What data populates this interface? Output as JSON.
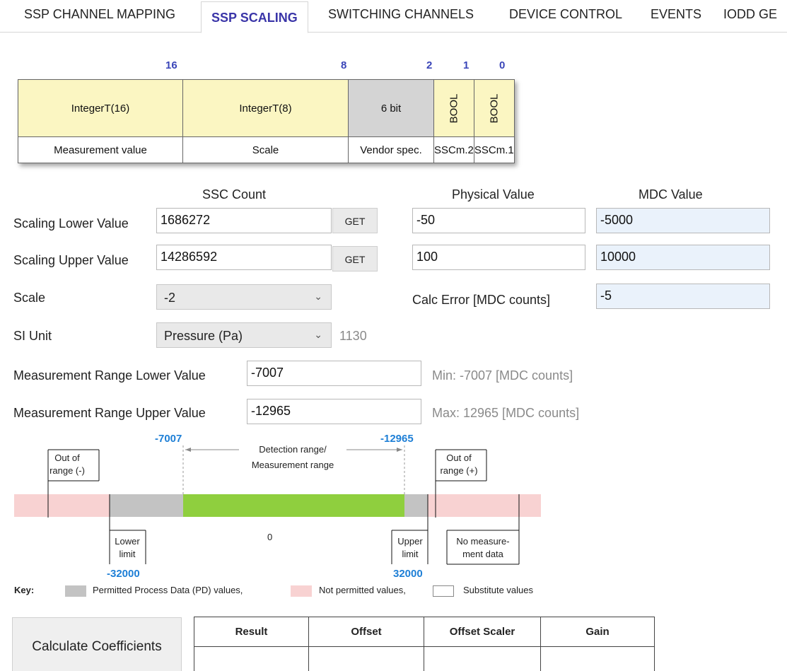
{
  "tabs": [
    {
      "label": "SSP CHANNEL MAPPING"
    },
    {
      "label": "SSP SCALING"
    },
    {
      "label": "SWITCHING CHANNELS"
    },
    {
      "label": "DEVICE CONTROL"
    },
    {
      "label": "EVENTS"
    },
    {
      "label": "IODD GE"
    }
  ],
  "bitlayout": {
    "bit_numbers": [
      "16",
      "8",
      "2",
      "1",
      "0"
    ],
    "types": [
      "IntegerT(16)",
      "IntegerT(8)",
      "6 bit",
      "BOOL",
      "BOOL"
    ],
    "names": [
      "Measurement value",
      "Scale",
      "Vendor spec.",
      "SSCm.2",
      "SSCm.1"
    ]
  },
  "form": {
    "headers": {
      "ssc_count": "SSC Count",
      "physical": "Physical Value",
      "mdc": "MDC Value"
    },
    "scaling_lower": {
      "label": "Scaling Lower Value",
      "ssc": "1686272",
      "get": "GET",
      "physical": "-50",
      "mdc": "-5000"
    },
    "scaling_upper": {
      "label": "Scaling Upper Value",
      "ssc": "14286592",
      "get": "GET",
      "physical": "100",
      "mdc": "10000"
    },
    "scale": {
      "label": "Scale",
      "value": "-2"
    },
    "calc_error": {
      "label": "Calc Error [MDC counts]",
      "value": "-5"
    },
    "si_unit": {
      "label": "SI Unit",
      "value": "Pressure (Pa)",
      "code": "1130"
    },
    "range_lower": {
      "label": "Measurement Range Lower Value",
      "value": "-7007",
      "hint": "Min: -7007 [MDC counts]"
    },
    "range_upper": {
      "label": "Measurement Range Upper Value",
      "value": "-12965",
      "hint": "Max: 12965 [MDC counts]"
    }
  },
  "diagram": {
    "top_left_value": "-7007",
    "top_right_value": "-12965",
    "detection_line1": "Detection range/",
    "detection_line2": "Measurement range",
    "out_minus_1": "Out of",
    "out_minus_2": "range (-)",
    "out_plus_1": "Out of",
    "out_plus_2": "range (+)",
    "zero": "0",
    "lower_limit_1": "Lower",
    "lower_limit_2": "limit",
    "upper_limit_1": "Upper",
    "upper_limit_2": "limit",
    "no_data_1": "No measure-",
    "no_data_2": "ment data",
    "bottom_left_value": "-32000",
    "bottom_right_value": "32000"
  },
  "key": {
    "title": "Key:",
    "permitted": "Permitted Process Data (PD) values,",
    "not_permitted": "Not permitted values,",
    "substitute": "Substitute values",
    "colors": {
      "permitted": "#c3c3c3",
      "not_permitted": "#f8d2d2",
      "substitute": "#ffffff",
      "range": "#8fcf3e"
    }
  },
  "results": {
    "calculate_label": "Calculate Coefficients",
    "columns": [
      "Result",
      "Offset",
      "Offset Scaler",
      "Gain"
    ]
  },
  "colors": {
    "accent": "#3a35a8",
    "number_blue": "#1e7fd6",
    "field_blue": "#eaf2fb"
  }
}
